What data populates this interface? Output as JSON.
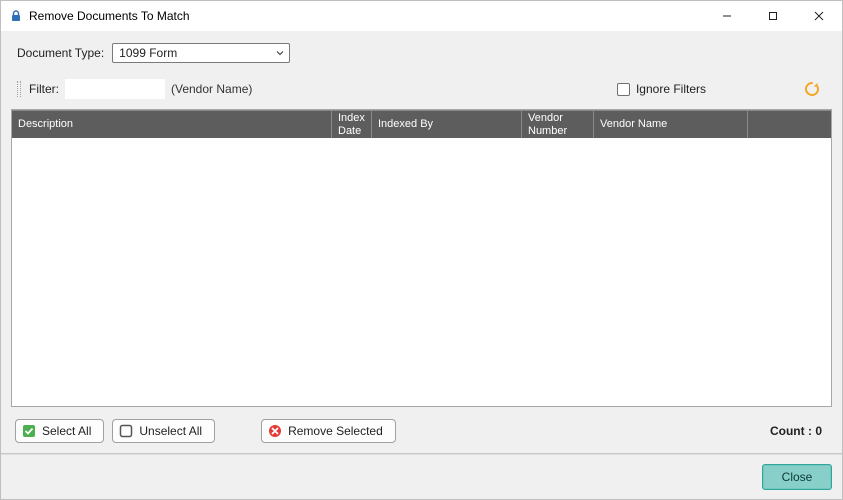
{
  "window": {
    "title": "Remove Documents To Match"
  },
  "doc_type": {
    "label": "Document Type:",
    "value": "1099 Form"
  },
  "filter": {
    "label": "Filter:",
    "value": "",
    "hint": "(Vendor Name)"
  },
  "ignore_filters": {
    "label": "Ignore Filters",
    "checked": false
  },
  "grid": {
    "columns": {
      "description": "Description",
      "index_date": "Index Date",
      "indexed_by": "Indexed By",
      "vendor_number": "Vendor Number",
      "vendor_name": "Vendor Name"
    },
    "rows": []
  },
  "buttons": {
    "select_all": "Select All",
    "unselect_all": "Unselect All",
    "remove_selected": "Remove Selected",
    "close": "Close"
  },
  "count": {
    "label": "Count :",
    "value": 0
  },
  "icons": {
    "app": "lock-icon",
    "refresh": "refresh-icon",
    "select_all": "check-square-icon",
    "unselect_all": "empty-square-icon",
    "remove": "remove-circle-icon"
  },
  "colors": {
    "header_bg": "#5d5d5d",
    "accent_close": "#88cfc9",
    "refresh": "#f5a623",
    "select_green": "#4caf50",
    "remove_red": "#e53935"
  }
}
